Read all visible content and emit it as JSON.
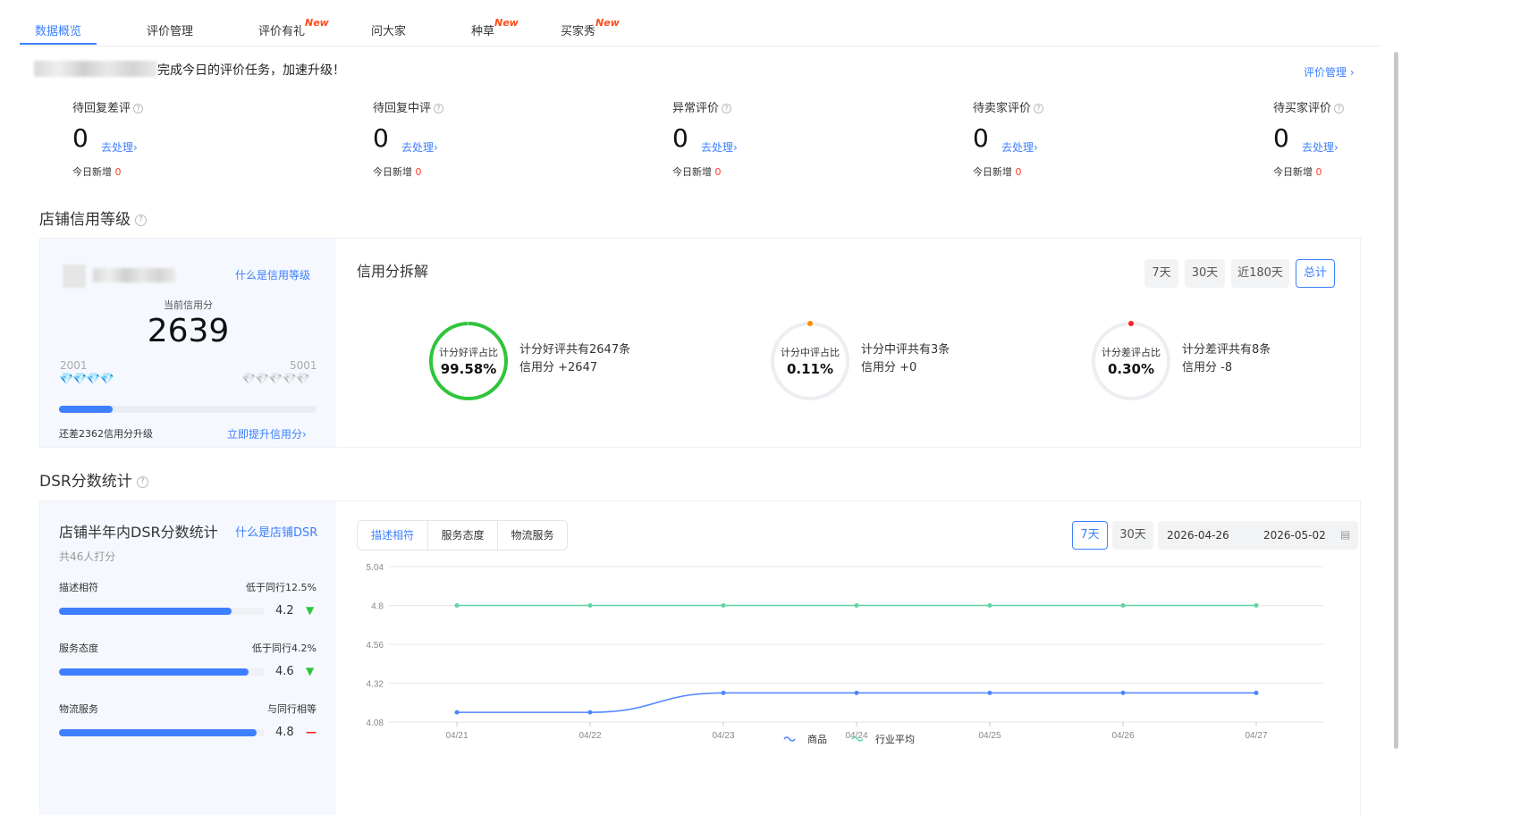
{
  "tabs": [
    {
      "label": "数据概览",
      "active": true
    },
    {
      "label": "评价管理",
      "active": false
    },
    {
      "label": "评价有礼",
      "badge": "New"
    },
    {
      "label": "问大家"
    },
    {
      "label": "种草",
      "badge": "New"
    },
    {
      "label": "买家秀",
      "badge": "New"
    }
  ],
  "notice": {
    "text": "完成今日的评价任务，加速升级！",
    "manage_link": "评价管理 ›"
  },
  "stats": [
    {
      "title": "待回复差评",
      "value": "0",
      "action": "去处理›",
      "sub_label": "今日新增",
      "sub_value": "0"
    },
    {
      "title": "待回复中评",
      "value": "0",
      "action": "去处理›",
      "sub_label": "今日新增",
      "sub_value": "0"
    },
    {
      "title": "异常评价",
      "value": "0",
      "action": "去处理›",
      "sub_label": "今日新增",
      "sub_value": "0"
    },
    {
      "title": "待卖家评价",
      "value": "0",
      "action": "去处理›",
      "sub_label": "今日新增",
      "sub_value": "0"
    },
    {
      "title": "待买家评价",
      "value": "0",
      "action": "去处理›",
      "sub_label": "今日新增",
      "sub_value": "0"
    }
  ],
  "credit": {
    "section_title": "店铺信用等级",
    "what_link": "什么是信用等级",
    "current_label": "当前信用分",
    "current_score": "2639",
    "min": "2001",
    "max": "5001",
    "progress_fraction": 0.21,
    "gap_text": "还差2362信用分升级",
    "improve_link": "立即提升信用分›"
  },
  "breakdown": {
    "title": "信用分拆解",
    "ranges": [
      {
        "label": "7天",
        "active": false
      },
      {
        "label": "30天",
        "active": false
      },
      {
        "label": "近180天",
        "active": false
      },
      {
        "label": "总计",
        "active": true
      }
    ],
    "rings": [
      {
        "label": "计分好评占比",
        "value": "99.58%",
        "desc1": "计分好评共有2647条",
        "desc2": "信用分 +2647",
        "color": "#2fc53a",
        "fraction": 0.9958
      },
      {
        "label": "计分中评占比",
        "value": "0.11%",
        "desc1": "计分中评共有3条",
        "desc2": "信用分 +0",
        "color": "#ff8a00",
        "fraction": 0.0011
      },
      {
        "label": "计分差评占比",
        "value": "0.30%",
        "desc1": "计分差评共有8条",
        "desc2": "信用分 -8",
        "color": "#ff2020",
        "fraction": 0.003
      }
    ]
  },
  "dsr": {
    "section_title": "DSR分数统计",
    "card_title": "店铺半年内DSR分数统计",
    "what_link": "什么是店铺DSR",
    "raters": "共46人打分",
    "items": [
      {
        "name": "描述相符",
        "compare": "低于同行12.5%",
        "score": "4.2",
        "trend": "▼",
        "trend_color": "#2fc53a",
        "fraction": 0.84
      },
      {
        "name": "服务态度",
        "compare": "低于同行4.2%",
        "score": "4.6",
        "trend": "▼",
        "trend_color": "#2fc53a",
        "fraction": 0.92
      },
      {
        "name": "物流服务",
        "compare": "与同行相等",
        "score": "4.8",
        "trend": "—",
        "trend_color": "#ff2020",
        "fraction": 0.96
      }
    ],
    "tabs": [
      {
        "label": "描述相符",
        "active": true
      },
      {
        "label": "服务态度",
        "active": false
      },
      {
        "label": "物流服务",
        "active": false
      }
    ],
    "ranges": [
      {
        "label": "7天",
        "active": true
      },
      {
        "label": "30天",
        "active": false
      }
    ],
    "date_start": "2026-04-26",
    "date_end": "2026-05-02"
  },
  "chart_data": {
    "type": "line",
    "x": [
      "04/21",
      "04/22",
      "04/23",
      "04/24",
      "04/25",
      "04/26",
      "04/27"
    ],
    "yticks": [
      "5.04",
      "4.8",
      "4.56",
      "4.32",
      "4.08"
    ],
    "ylim": [
      4.08,
      5.04
    ],
    "series": [
      {
        "name": "商品",
        "color": "#4c84ff",
        "values": [
          4.14,
          4.14,
          4.26,
          4.26,
          4.26,
          4.26,
          4.26
        ]
      },
      {
        "name": "行业平均",
        "color": "#5fd6a4",
        "values": [
          4.8,
          4.8,
          4.8,
          4.8,
          4.8,
          4.8,
          4.8
        ]
      }
    ],
    "grid": true,
    "legend": "bottom-center"
  }
}
